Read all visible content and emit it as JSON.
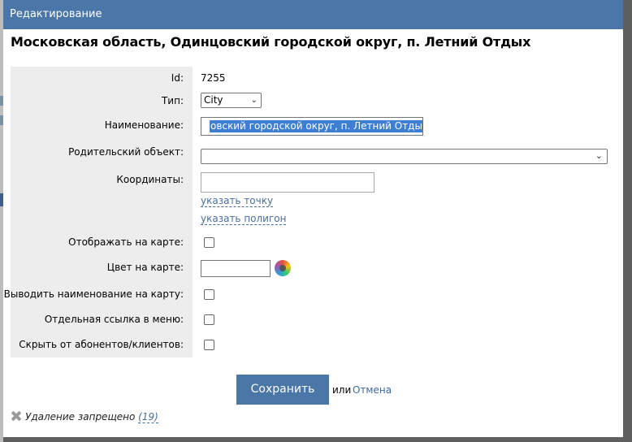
{
  "dialog": {
    "title": "Редактирование",
    "heading": "Московская область, Одинцовский городской округ, п. Летний Отдых"
  },
  "form": {
    "id_label": "Id:",
    "id_value": "7255",
    "type_label": "Тип:",
    "type_selected": "City",
    "name_label": "Наименование:",
    "name_value_visible": "овский городской округ, п. Летний Отдых",
    "parent_label": "Родительский объект:",
    "parent_selected": "",
    "coords_label": "Координаты:",
    "coords_value": "",
    "point_link": "указать точку",
    "polygon_link": "указать полигон",
    "show_on_map_label": "Отображать на карте:",
    "show_on_map_checked": false,
    "map_color_label": "Цвет на карте:",
    "map_color_value": "",
    "show_name_on_map_label": "Выводить наименование на карту:",
    "show_name_on_map_checked": false,
    "menu_link_label": "Отдельная ссылка в меню:",
    "menu_link_checked": false,
    "hide_from_clients_label": "Скрыть от абонентов/клиентов:",
    "hide_from_clients_checked": false
  },
  "actions": {
    "save_label": "Сохранить",
    "or_text": "или",
    "cancel_label": "Отмена"
  },
  "footer": {
    "delete_text": "Удаление запрещено",
    "delete_count": "(19)"
  },
  "icons": {
    "type_dropdown": "chevron-down-icon",
    "parent_dropdown": "chevron-down-icon",
    "color_picker": "color-wheel-icon",
    "delete_forbidden": "close-icon"
  },
  "colors": {
    "titlebar": "#4a76a8",
    "save_button": "#4a76a8",
    "link": "#4a6f9a",
    "label_panel": "#ededed",
    "selection": "#3e7fd3"
  }
}
